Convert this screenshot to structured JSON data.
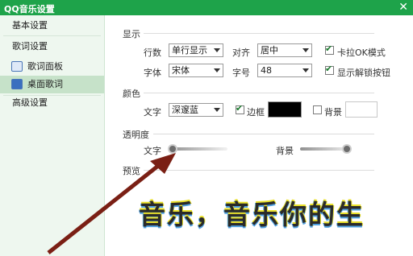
{
  "window": {
    "title": "QQ音乐设置",
    "close_glyph": "✕",
    "accent": "#1ea34a"
  },
  "sidebar": {
    "items": [
      {
        "label": "基本设置"
      },
      {
        "label": "歌词设置"
      },
      {
        "label": "歌词面板",
        "icon": "lyrics-panel-icon"
      },
      {
        "label": "桌面歌词",
        "icon": "desktop-lyrics-icon",
        "active": true
      },
      {
        "label": "高级设置"
      }
    ]
  },
  "display": {
    "section": "显示",
    "lines_label": "行数",
    "lines_value": "单行显示",
    "align_label": "对齐",
    "align_value": "居中",
    "karaoke_label": "卡拉OK模式",
    "karaoke_checked": true,
    "font_label": "字体",
    "font_value": "宋体",
    "size_label": "字号",
    "size_value": "48",
    "unlock_label": "显示解锁按钮",
    "unlock_checked": true
  },
  "color": {
    "section": "颜色",
    "text_label": "文字",
    "text_value": "深邃蓝",
    "border_label": "边框",
    "border_checked": true,
    "border_color": "#000000",
    "bg_label": "背景",
    "bg_checked": false,
    "bg_color": "#ffffff"
  },
  "transparency": {
    "section": "透明度",
    "text_label": "文字",
    "text_level": 0.05,
    "bg_label": "背景",
    "bg_level": 0.9
  },
  "preview": {
    "section": "预览",
    "text": "音乐，音乐你的生"
  },
  "check_glyph": "✔"
}
